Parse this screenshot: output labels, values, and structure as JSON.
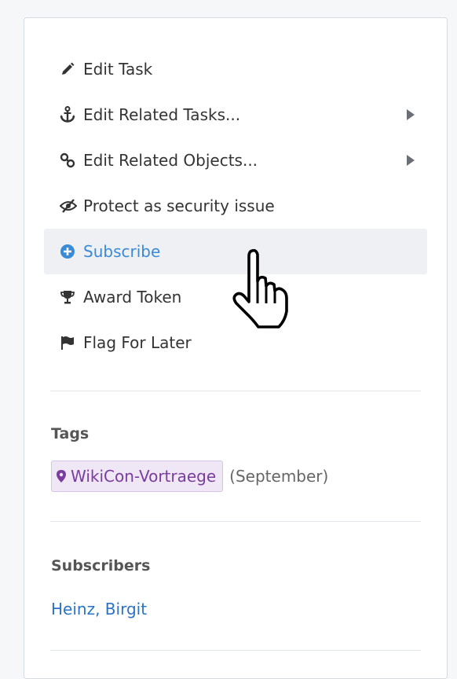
{
  "menu": {
    "items": [
      {
        "label": "Edit Task",
        "icon": "pencil-icon"
      },
      {
        "label": "Edit Related Tasks...",
        "icon": "anchor-icon",
        "submenu": true
      },
      {
        "label": "Edit Related Objects...",
        "icon": "link-icon",
        "submenu": true
      },
      {
        "label": "Protect as security issue",
        "icon": "eye-slash-icon"
      },
      {
        "label": "Subscribe",
        "icon": "plus-circle-icon",
        "active": true
      },
      {
        "label": "Award Token",
        "icon": "trophy-icon"
      },
      {
        "label": "Flag For Later",
        "icon": "flag-icon"
      }
    ]
  },
  "tags": {
    "title": "Tags",
    "items": [
      {
        "label": "WikiCon-Vortraege",
        "note": "(September)",
        "icon": "map-pin-icon"
      }
    ]
  },
  "subscribers": {
    "title": "Subscribers",
    "names": [
      "Heinz",
      "Birgit"
    ],
    "separator": ", "
  },
  "colors": {
    "accent": "#3a8ad6",
    "link": "#2a73c5",
    "tag_bg": "#efe7f5",
    "tag_text": "#7a3d9e",
    "active_bg": "#eef0f3"
  },
  "cursor": "hand-pointer-icon"
}
